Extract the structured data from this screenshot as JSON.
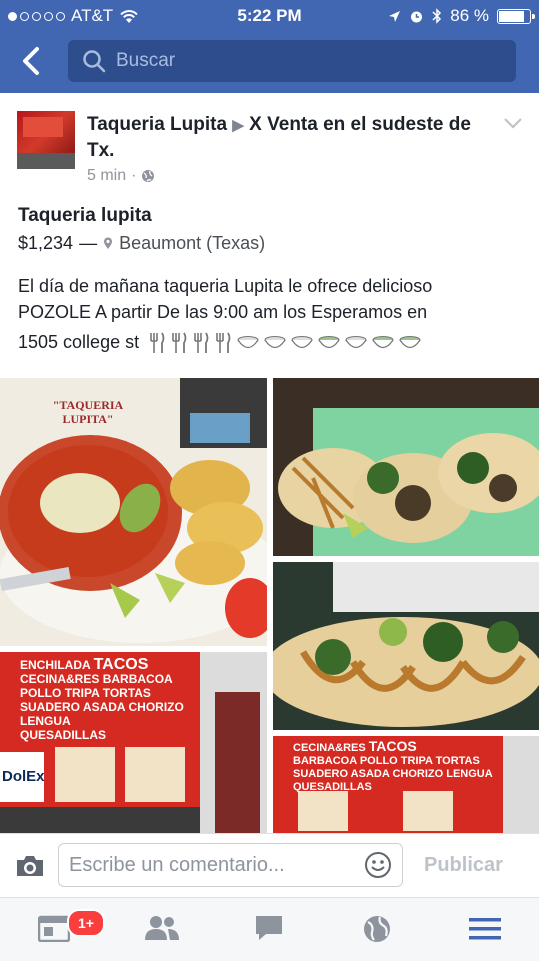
{
  "status_bar": {
    "carrier": "AT&T",
    "time": "5:22 PM",
    "battery": "86 %",
    "battery_level": 0.86
  },
  "nav": {
    "search_placeholder": "Buscar"
  },
  "post": {
    "author": "Taqueria Lupita",
    "arrow": "▶",
    "group": "X Venta en el sudeste de Tx.",
    "time": "5 min",
    "separator": "·",
    "listing_title": "Taqueria lupita",
    "price": "$1,234",
    "dash": "—",
    "location": "Beaumont (Texas)",
    "text_line1": "El día de mañana taqueria Lupita  le ofrece delicioso",
    "text_line2": "POZOLE    A partir De las 9:00 am  los Esperamos en",
    "text_line3": "1505 college st"
  },
  "photos": {
    "sign_text": "\"TAQUERIA LUPITA\"",
    "wall1": [
      "ENCHILADA",
      "TACOS",
      "CECINA",
      "&RES",
      "BARBACOA",
      "POLLO",
      "TRIPA",
      "TORTAS",
      "SUADERO",
      "ASADA",
      "CHORIZO",
      "LENGUA",
      "QUESADILLAS"
    ],
    "dolex": "DolEx",
    "wall2": [
      "CECINA",
      "&RES",
      "TACOS",
      "BARBACOA",
      "POLLO",
      "TRIPA",
      "TORTAS",
      "SUADERO",
      "ASADA",
      "CHORIZO",
      "LENGUA",
      "QUESADILLAS"
    ]
  },
  "comment": {
    "placeholder": "Escribe un comentario...",
    "publish": "Publicar"
  },
  "tabbar": {
    "badge": "1+"
  },
  "colors": {
    "facebook_blue": "#4267b2",
    "search_bg": "#2d4d8d",
    "badge_red": "#fa3e3e"
  }
}
